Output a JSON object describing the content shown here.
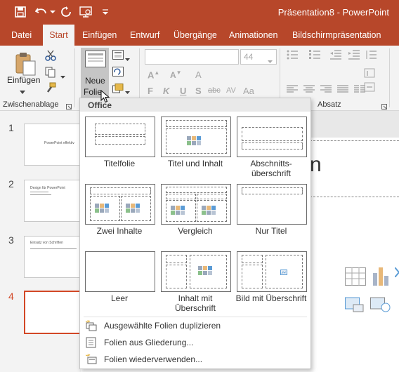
{
  "titlebar": {
    "title": "Präsentation8  -  PowerPoint",
    "bg": "#b7472a"
  },
  "menu": {
    "tabs": [
      "Datei",
      "Start",
      "Einfügen",
      "Entwurf",
      "Übergänge",
      "Animationen",
      "Bildschirmpräsentation"
    ],
    "active": "Start"
  },
  "ribbon": {
    "paste_label": "Einfügen",
    "new_slide_label_1": "Neue",
    "new_slide_label_2": "Folie",
    "font_size": "44",
    "clipboard_label": "Zwischenablage",
    "paragraph_label": "Absatz",
    "format_buttons": [
      "F",
      "K",
      "U",
      "S",
      "abc",
      "AV",
      "Aa"
    ]
  },
  "slides": [
    {
      "num": "1",
      "text": "PowerPoint effektiv"
    },
    {
      "num": "2",
      "text": "Design für PowerPoint"
    },
    {
      "num": "3",
      "text": "Einsatz von Schriften"
    },
    {
      "num": "4",
      "text": ""
    }
  ],
  "dropdown": {
    "header": "Office",
    "layouts": [
      {
        "name": "Titelfolie"
      },
      {
        "name": "Titel und Inhalt"
      },
      {
        "name": "Abschnitts-überschrift"
      },
      {
        "name": "Zwei Inhalte"
      },
      {
        "name": "Vergleich"
      },
      {
        "name": "Nur Titel"
      },
      {
        "name": "Leer"
      },
      {
        "name": "Inhalt mit Überschrift"
      },
      {
        "name": "Bild mit Überschrift"
      }
    ],
    "commands": [
      "Ausgewählte Folien duplizieren",
      "Folien aus Gliederung...",
      "Folien wiederverwenden..."
    ]
  }
}
